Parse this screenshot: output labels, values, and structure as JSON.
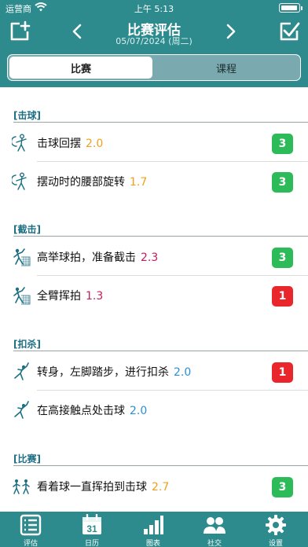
{
  "status": {
    "carrier": "运营商",
    "time": "上午 5:13"
  },
  "nav": {
    "title": "比赛评估",
    "date": "05/07/2024 (周二)"
  },
  "segments": [
    {
      "label": "比赛"
    },
    {
      "label": "课程"
    }
  ],
  "sections": [
    {
      "title": "[击球]",
      "items": [
        {
          "label": "击球回摆",
          "value": "2.0",
          "value_color": "#f0a01a",
          "score": "3",
          "score_color": "#2dbb5a",
          "icon": "swing-stroke-icon"
        },
        {
          "label": "摆动时的腰部旋转",
          "value": "1.7",
          "value_color": "#f0a01a",
          "score": "3",
          "score_color": "#2dbb5a",
          "icon": "swing-stroke-icon"
        }
      ]
    },
    {
      "title": "[截击]",
      "items": [
        {
          "label": "高举球拍，准备截击",
          "value": "2.3",
          "value_color": "#c21d5c",
          "score": "3",
          "score_color": "#2dbb5a",
          "icon": "volley-icon"
        },
        {
          "label": "全臂挥拍",
          "value": "1.3",
          "value_color": "#c21d5c",
          "score": "1",
          "score_color": "#e8262b",
          "icon": "volley-icon"
        }
      ]
    },
    {
      "title": "[扣杀]",
      "items": [
        {
          "label": "转身，左脚踏步，进行扣杀",
          "value": "2.0",
          "value_color": "#2b8fd6",
          "score": "1",
          "score_color": "#e8262b",
          "icon": "smash-icon"
        },
        {
          "label": "在高接触点处击球",
          "value": "2.0",
          "value_color": "#2b8fd6",
          "score": "",
          "score_color": "",
          "icon": "smash-icon"
        }
      ]
    },
    {
      "title": "[比赛]",
      "items": [
        {
          "label": "看着球一直挥拍到击球",
          "value": "2.7",
          "value_color": "#f0a01a",
          "score": "3",
          "score_color": "#2dbb5a",
          "icon": "match-players-icon"
        }
      ]
    }
  ],
  "tabs": [
    {
      "label": "评估",
      "icon": "evaluation-list-icon"
    },
    {
      "label": "日历",
      "icon": "calendar-icon",
      "calendar_day": "31"
    },
    {
      "label": "图表",
      "icon": "bar-chart-icon"
    },
    {
      "label": "社交",
      "icon": "people-icon"
    },
    {
      "label": "设置",
      "icon": "gear-icon"
    }
  ],
  "colors": {
    "primary": "#2e8b8d",
    "section_title": "#1d6f84",
    "good": "#2dbb5a",
    "bad": "#e8262b"
  }
}
